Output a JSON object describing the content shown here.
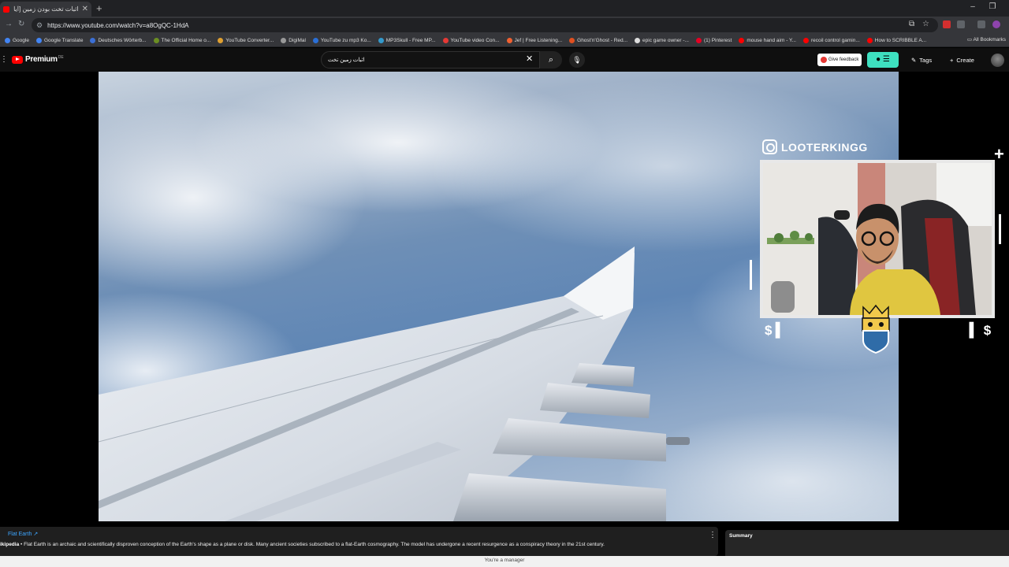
{
  "browser": {
    "tab_title": "اثبات تخت بودن زمین [آیا زمین ت...",
    "url": "https://www.youtube.com/watch?v=a8OgQC-1HdA",
    "bookmarks": [
      {
        "label": "Google",
        "color": "#4285f4"
      },
      {
        "label": "Google Translate",
        "color": "#4285f4"
      },
      {
        "label": "Deutsches Wörterb...",
        "color": "#3b6fd6"
      },
      {
        "label": "The Official Home o...",
        "color": "#6b8e23"
      },
      {
        "label": "YouTube Converter...",
        "color": "#e0a030"
      },
      {
        "label": "DigiMal",
        "color": "#999999"
      },
      {
        "label": "YouTube zu mp3 Ko...",
        "color": "#2a6fd6"
      },
      {
        "label": "MP3Skull - Free MP...",
        "color": "#3399cc"
      },
      {
        "label": "YouTube video Con...",
        "color": "#e53935"
      },
      {
        "label": "Jef | Free Listening...",
        "color": "#f06030"
      },
      {
        "label": "Ghost'n'Ghost - Red...",
        "color": "#e05020"
      },
      {
        "label": "epic game owner -...",
        "color": "#dddddd"
      },
      {
        "label": "(1) Pinterest",
        "color": "#e60023"
      },
      {
        "label": "mouse hand aim - Y...",
        "color": "#ff0000"
      },
      {
        "label": "recoil control gamin...",
        "color": "#ff0000"
      },
      {
        "label": "How to SCRIBBLE A...",
        "color": "#ff0000"
      }
    ],
    "all_bookmarks": "All Bookmarks"
  },
  "youtube": {
    "logo_text": "Premium",
    "country_code": "DE",
    "search_query": "اثبات زمین تخت",
    "feedback_label": "Give feedback",
    "tags_label": "Tags",
    "create_label": "Create"
  },
  "overlay": {
    "handle": "LOOTERKINGG",
    "dollar": "$"
  },
  "info_panel": {
    "title": "Flat Earth",
    "source": "ikipedia",
    "text": " • Flat Earth is an archaic and scientifically disproven conception of the Earth's shape as a plane or disk. Many ancient societies subscribed to a flat-Earth cosmography. The model has undergone a recent resurgence as a conspiracy theory in the 21st century."
  },
  "summary": {
    "title": "Summary"
  },
  "status": {
    "manager_text": "You're a manager"
  }
}
